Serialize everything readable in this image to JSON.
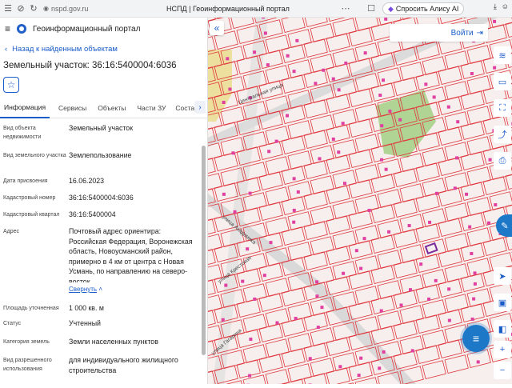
{
  "browser": {
    "url": "nspd.gov.ru",
    "tab_title": "НСПД | Геоинформационный портал",
    "alice_label": "Спросить Алису AI"
  },
  "panel": {
    "portal_name": "Геоинформационный портал",
    "back_link": "Назад к найденным объектам",
    "object_title": "Земельный участок: 36:16:5400004:6036",
    "tabs": [
      {
        "label": "Информация",
        "active": true
      },
      {
        "label": "Сервисы",
        "active": false
      },
      {
        "label": "Объекты",
        "active": false
      },
      {
        "label": "Части ЗУ",
        "active": false
      },
      {
        "label": "Состав",
        "active": false
      }
    ],
    "rows": [
      {
        "label": "Вид объекта недвижимости",
        "value": "Земельный участок"
      },
      {
        "label": "Вид земельного участка",
        "value": "Землепользование"
      },
      {
        "label": "Дата присвоения",
        "value": "16.06.2023"
      },
      {
        "label": "Кадастровый номер",
        "value": "36:16:5400004:6036"
      },
      {
        "label": "Кадастровый квартал",
        "value": "36:16:5400004"
      },
      {
        "label": "Адрес",
        "value": "Почтовый адрес ориентира: Российская Федерация, Воронежская область, Новоусманский район, примерно в 4 км от центра с Новая Усмань, по направлению на северо-восток"
      },
      {
        "label": "Площадь уточненная",
        "value": "1 000 кв. м"
      },
      {
        "label": "Статус",
        "value": "Учтенный"
      },
      {
        "label": "Категория земель",
        "value": "Земли населенных пунктов"
      },
      {
        "label": "Вид разрешенного использования",
        "value": "для индивидуального жилищного строительства"
      }
    ],
    "collapse_label": "Свернуть"
  },
  "map": {
    "login_label": "Войти",
    "streets": [
      "Центральная улица",
      "улица Академика",
      "улица Крестовая",
      "улица Гагарина"
    ],
    "colors": {
      "parcel": "#e0383e",
      "building": "#e040a0",
      "park": "#a8d08a",
      "road": "#cfd0d0"
    }
  }
}
